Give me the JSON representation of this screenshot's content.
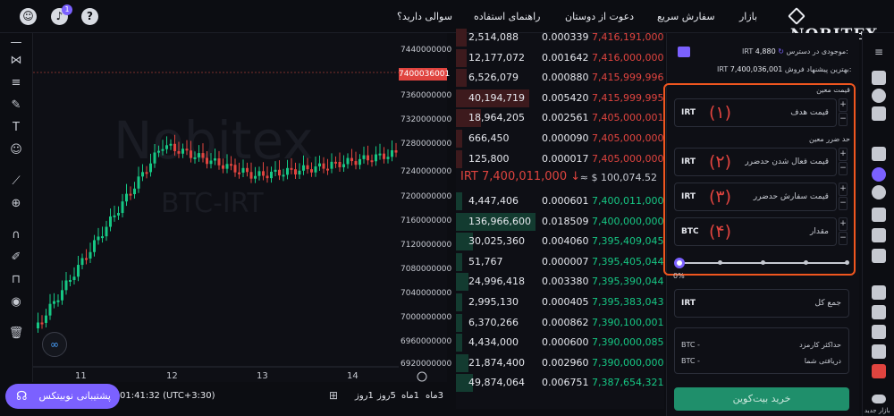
{
  "header": {
    "logo": "NOBITEX",
    "nav": [
      "بازار",
      "سفارش سریع",
      "دعوت از دوستان",
      "راهنمای استفاده",
      "سوالی دارید؟"
    ],
    "notif_count": "1"
  },
  "chart": {
    "watermark": "Nobitex",
    "pair_watermark": "BTC-IRT",
    "price_ticks": [
      "7440000000",
      "7400036001",
      "7360000000",
      "7320000000",
      "7280000000",
      "7240000000",
      "7200000000",
      "7160000000",
      "7120000000",
      "7080000000",
      "7040000000",
      "7000000000",
      "6960000000",
      "6920000000"
    ],
    "current_price": "7400036001",
    "x_ticks": [
      "11",
      "12",
      "13",
      "14"
    ],
    "timestamp": "01:41:32 (UTC+3:30)",
    "timeframes": [
      "1روز",
      "5روز",
      "1ماه",
      "3ماه"
    ],
    "support_button": "پشتیبانی نوبیتکس"
  },
  "orderbook": {
    "asks": [
      {
        "total": "2,514,088",
        "amount": "0.000339",
        "price": "7,416,191,000",
        "depth": 0.05
      },
      {
        "total": "12,177,072",
        "amount": "0.001642",
        "price": "7,416,000,000",
        "depth": 0.05
      },
      {
        "total": "6,526,079",
        "amount": "0.000880",
        "price": "7,415,999,996",
        "depth": 0.05
      },
      {
        "total": "40,194,719",
        "amount": "0.005420",
        "price": "7,415,999,995",
        "depth": 0.35
      },
      {
        "total": "18,964,205",
        "amount": "0.002561",
        "price": "7,405,000,001",
        "depth": 0.12
      },
      {
        "total": "666,450",
        "amount": "0.000090",
        "price": "7,405,000,000",
        "depth": 0.03
      },
      {
        "total": "125,800",
        "amount": "0.000017",
        "price": "7,405,000,000",
        "depth": 0.03
      }
    ],
    "last_price": "IRT 7,400,011,000 ↓",
    "usd_price": "≈ $ 100,074.52",
    "bids": [
      {
        "total": "4,447,406",
        "amount": "0.000601",
        "price": "7,400,011,000",
        "depth": 0.03
      },
      {
        "total": "136,966,600",
        "amount": "0.018509",
        "price": "7,400,000,000",
        "depth": 0.38
      },
      {
        "total": "30,025,360",
        "amount": "0.004060",
        "price": "7,395,409,045",
        "depth": 0.08
      },
      {
        "total": "51,767",
        "amount": "0.000007",
        "price": "7,395,405,044",
        "depth": 0.03
      },
      {
        "total": "24,996,418",
        "amount": "0.003380",
        "price": "7,395,390,044",
        "depth": 0.06
      },
      {
        "total": "2,995,130",
        "amount": "0.000405",
        "price": "7,395,383,043",
        "depth": 0.03
      },
      {
        "total": "6,370,266",
        "amount": "0.000862",
        "price": "7,390,100,001",
        "depth": 0.03
      },
      {
        "total": "4,434,000",
        "amount": "0.000600",
        "price": "7,390,000,085",
        "depth": 0.03
      },
      {
        "total": "21,874,400",
        "amount": "0.002960",
        "price": "7,390,000,000",
        "depth": 0.06
      },
      {
        "total": "49,874,064",
        "amount": "0.006751",
        "price": "7,387,654,321",
        "depth": 0.08
      }
    ]
  },
  "form": {
    "balance_label": "موجودی در دسترس:",
    "balance_value": "4,880",
    "balance_unit": "IRT",
    "best_offer_label": "بهترین پیشنهاد فروش:",
    "best_offer_value": "7,400,036,001",
    "best_offer_unit": "IRT",
    "section_price": "قیمت معین",
    "section_stop": "حد ضرر معین",
    "fields": [
      {
        "unit": "IRT",
        "label": "قیمت هدف",
        "marker": "(۱)"
      },
      {
        "unit": "IRT",
        "label": "قیمت فعال شدن حدضرر",
        "marker": "(۲)"
      },
      {
        "unit": "IRT",
        "label": "قیمت سفارش حدضرر",
        "marker": "(۳)"
      },
      {
        "unit": "BTC",
        "label": "مقدار",
        "marker": "(۴)"
      }
    ],
    "slider_percent": "0%",
    "slider_value": 0,
    "total_unit": "IRT",
    "total_label": "جمع کل",
    "max_fee_label": "حداکثر کارمزد",
    "max_fee_value": "BTC -",
    "receive_label": "دریافتی شما",
    "receive_value": "BTC -",
    "submit": "خرید بیت‌کوین"
  },
  "sidebar": {
    "bottom_label": "بازار جدید"
  },
  "colors": {
    "up": "#16c784",
    "down": "#e0443f",
    "accent": "#7b61ff",
    "highlight": "#f0561f",
    "buy": "#1f8f6b"
  }
}
